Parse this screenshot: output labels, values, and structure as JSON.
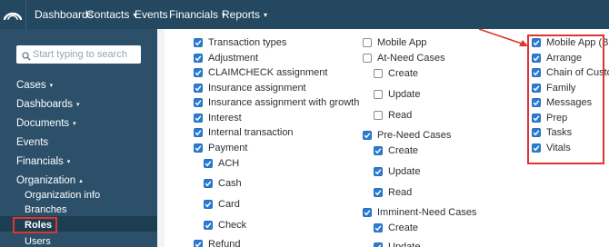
{
  "topnav": {
    "items": [
      {
        "label": "Dashboards",
        "caret": false
      },
      {
        "label": "Contacts",
        "caret": true
      },
      {
        "label": "Events",
        "caret": false
      },
      {
        "label": "Financials",
        "caret": true
      },
      {
        "label": "Reports",
        "caret": true
      }
    ]
  },
  "sidebar": {
    "search_placeholder": "Start typing to search",
    "items": [
      {
        "label": "Cases",
        "caret": "▾"
      },
      {
        "label": "Dashboards",
        "caret": "▾"
      },
      {
        "label": "Documents",
        "caret": "▾"
      },
      {
        "label": "Events",
        "caret": ""
      },
      {
        "label": "Financials",
        "caret": "▾"
      },
      {
        "label": "Organization",
        "caret": "▴"
      }
    ],
    "subitems": [
      {
        "label": "Organization info"
      },
      {
        "label": "Branches"
      },
      {
        "label": "Roles",
        "active": true
      },
      {
        "label": "Users"
      }
    ]
  },
  "permissions": {
    "col1": [
      {
        "label": "Transaction types",
        "checked": true
      },
      {
        "label": "Adjustment",
        "checked": true
      },
      {
        "label": "CLAIMCHECK assignment",
        "checked": true
      },
      {
        "label": "Insurance assignment",
        "checked": true
      },
      {
        "label": "Insurance assignment with growth",
        "checked": true
      },
      {
        "label": "Interest",
        "checked": true
      },
      {
        "label": "Internal transaction",
        "checked": true
      },
      {
        "label": "Payment",
        "checked": true
      },
      {
        "label": "ACH",
        "checked": true
      },
      {
        "label": "Cash",
        "checked": true
      },
      {
        "label": "Card",
        "checked": true
      },
      {
        "label": "Check",
        "checked": true
      },
      {
        "label": "Refund",
        "checked": true
      }
    ],
    "col2": [
      {
        "label": "Mobile App",
        "checked": false
      },
      {
        "label": "At-Need Cases",
        "checked": false
      },
      {
        "label": "Create",
        "checked": false
      },
      {
        "label": "Update",
        "checked": false
      },
      {
        "label": "Read",
        "checked": false
      },
      {
        "label": "Pre-Need Cases",
        "checked": true
      },
      {
        "label": "Create",
        "checked": true
      },
      {
        "label": "Update",
        "checked": true
      },
      {
        "label": "Read",
        "checked": true
      },
      {
        "label": "Imminent-Need Cases",
        "checked": true
      },
      {
        "label": "Create",
        "checked": true
      },
      {
        "label": "Update",
        "checked": true
      }
    ],
    "col3": [
      {
        "label": "Mobile App (Beta)",
        "checked": true
      },
      {
        "label": "Arrange",
        "checked": true
      },
      {
        "label": "Chain of Custody",
        "checked": true
      },
      {
        "label": "Family",
        "checked": true
      },
      {
        "label": "Messages",
        "checked": true
      },
      {
        "label": "Prep",
        "checked": true
      },
      {
        "label": "Tasks",
        "checked": true
      },
      {
        "label": "Vitals",
        "checked": true
      }
    ]
  },
  "colors": {
    "nav_bg": "#24485f",
    "sidebar_bg": "#2c5069",
    "checkbox_blue": "#2a7bd3",
    "highlight_red": "#e0342c"
  }
}
